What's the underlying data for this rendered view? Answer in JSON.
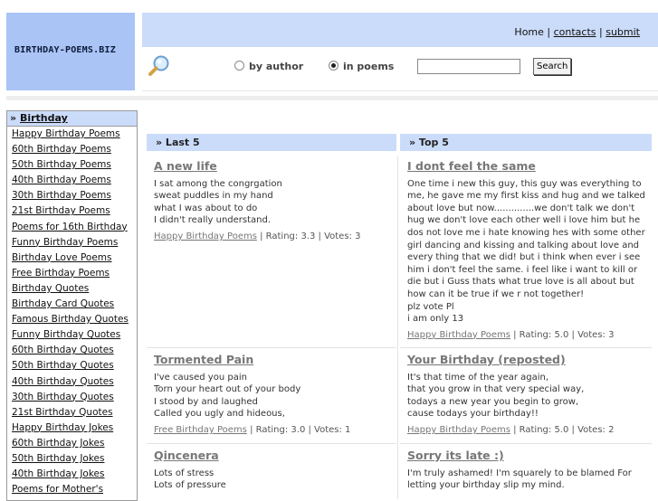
{
  "site": {
    "logo": "BIRTHDAY-POEMS.BIZ"
  },
  "header": {
    "links": [
      {
        "label": "Home"
      },
      {
        "label": "contacts"
      },
      {
        "label": "submit"
      }
    ],
    "separator": " | ",
    "search": {
      "options": [
        {
          "label": "by author",
          "selected": false
        },
        {
          "label": "in poems",
          "selected": true
        }
      ],
      "input_value": "",
      "button_label": "Search"
    }
  },
  "sidebar": {
    "heading_prefix": "» ",
    "heading": "Birthday",
    "items": [
      "Happy Birthday Poems",
      "60th Birthday Poems",
      "50th Birthday Poems",
      "40th Birthday Poems",
      "30th Birthday Poems",
      "21st Birthday Poems",
      "Poems for 16th Birthday",
      "Funny Birthday Poems",
      "Birthday Love Poems",
      "Free Birthday Poems",
      "Birthday Quotes",
      "Birthday Card Quotes",
      "Famous Birthday Quotes",
      "Funny Birthday Quotes",
      "60th Birthday Quotes",
      "50th Birthday Quotes",
      "40th Birthday Quotes",
      "30th Birthday Quotes",
      "21st Birthday Quotes",
      "Happy Birthday Jokes",
      "60th Birthday Jokes",
      "50th Birthday Jokes",
      "40th Birthday Jokes",
      "Poems for Mother's"
    ]
  },
  "columns": {
    "left_title": "»  Last 5",
    "right_title": "»  Top 5"
  },
  "left_entries": [
    {
      "title": "A new life",
      "body": "I sat among the congrgation\nsweat puddles in my hand\nwhat I was about to do\nI didn't really understand.",
      "category": "Happy Birthday Poems",
      "stats": " | Rating: 3.3 | Votes: 3"
    },
    {
      "title": "Tormented Pain",
      "body": "I've caused you pain\nTorn your heart out of your body\nI stood by and laughed\nCalled you ugly and hideous,",
      "category": "Free Birthday Poems",
      "stats": " | Rating: 3.0 | Votes: 1"
    },
    {
      "title": "Qincenera",
      "body": "Lots of stress\nLots of pressure",
      "category": "",
      "stats": ""
    }
  ],
  "right_entries": [
    {
      "title": "I dont feel the same",
      "body": "One time i new this guy, this guy was everything to me, he gave me my first kiss and hug and we talked about love but now..............we don't talk we don't hug we don't love each other well i love him but he dos not love me i hate knowing hes with some other girl dancing and kissing and talking about love and every thing that we did! but i think when ever i see him i don't feel the same. i feel like i want to kill or die but i Guss thats what true love is all about but how can it be true if we r not together!\nplz vote Pl\ni am only 13",
      "category": "Happy Birthday Poems",
      "stats": " | Rating: 5.0 | Votes: 3"
    },
    {
      "title": "Your Birthday (reposted)",
      "body": "It's that time of the year again,\nthat you grow in that very special way,\ntodays a new year you begin to grow,\ncause todays your birthday!!",
      "category": "Happy Birthday Poems",
      "stats": " | Rating: 5.0 | Votes: 2"
    },
    {
      "title": "Sorry its late :)",
      "body": "I'm truly ashamed! I'm squarely to be blamed For letting your birthday slip my mind.",
      "category": "",
      "stats": ""
    }
  ]
}
